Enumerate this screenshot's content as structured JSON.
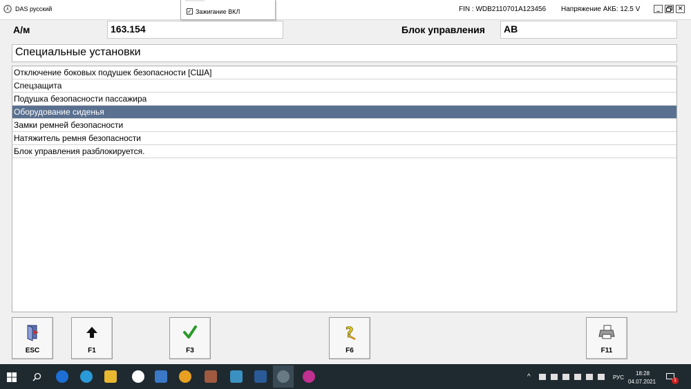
{
  "window": {
    "title": "DAS русский",
    "fin": "FIN : WDB2110701A123456",
    "voltage": "Напряжение АКБ: 12.5 V"
  },
  "popup": {
    "checkbox_label": "Зажигание ВКЛ",
    "checked": true
  },
  "header": {
    "am_label": "А/м",
    "am_value": "163.154",
    "ecu_label": "Блок управления",
    "ecu_value": "AB"
  },
  "section": {
    "title": "Специальные установки"
  },
  "list": {
    "items": [
      "Отключение боковых подушек безопасности [США]",
      "Спецзащита",
      "Подушка безопасности пассажира",
      "Оборудование сиденья",
      "Замки ремней безопасности",
      "Натяжитель ремня безопасности",
      "Блок управления разблокируется."
    ],
    "selected_index": 3
  },
  "toolbar": {
    "esc": "ESC",
    "f1": "F1",
    "f3": "F3",
    "f6": "F6",
    "f11": "F11"
  },
  "taskbar": {
    "language": "РУС",
    "time": "18:28",
    "date": "04.07.2021",
    "notification_count": "1"
  },
  "colors": {
    "selected_row": "#5a7090",
    "taskbar": "#1f2a30"
  }
}
